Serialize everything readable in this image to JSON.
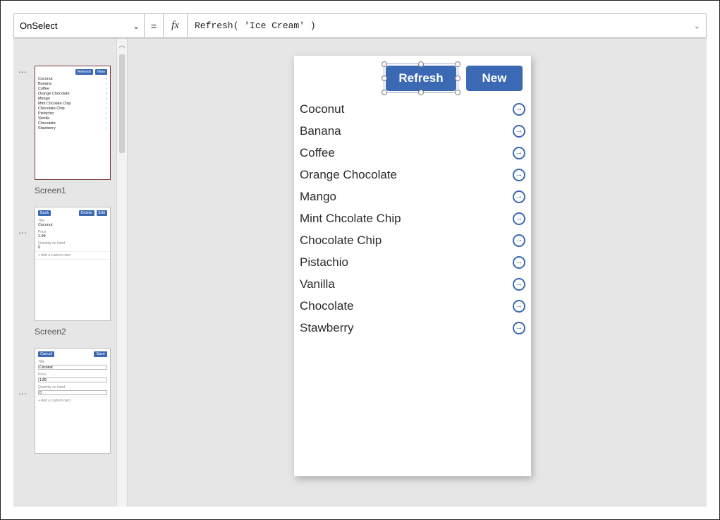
{
  "topbar": {
    "property": "OnSelect",
    "equals": "=",
    "fx": "fx",
    "formula": "Refresh( 'Ice Cream' )"
  },
  "thumbs": {
    "screen1_label": "Screen1",
    "screen2_label": "Screen2",
    "t1_buttons": {
      "refresh": "Refresh",
      "new": "New"
    },
    "t2_buttons": {
      "back": "Back",
      "delete": "Delete",
      "edit": "Edit"
    },
    "t2_fields": {
      "title_lbl": "Title",
      "title_val": "Coconut",
      "price_lbl": "Price",
      "price_val": "1.89",
      "qty_lbl": "Quantity on hand",
      "qty_val": "0",
      "add_card": "+  Add a custom card"
    },
    "t3_buttons": {
      "cancel": "Cancel",
      "save": "Save"
    },
    "t3_fields": {
      "title_lbl": "Title",
      "title_val": "Coconut",
      "price_lbl": "Price",
      "price_val": "1.89",
      "qty_lbl": "Quantity on hand",
      "qty_val": "0",
      "add_card": "+  Add a custom card"
    }
  },
  "canvas": {
    "refresh_label": "Refresh",
    "new_label": "New",
    "items": [
      "Coconut",
      "Banana",
      "Coffee",
      "Orange Chocolate",
      "Mango",
      "Mint Chcolate Chip",
      "Chocolate Chip",
      "Pistachio",
      "Vanilla",
      "Chocolate",
      "Stawberry"
    ]
  }
}
